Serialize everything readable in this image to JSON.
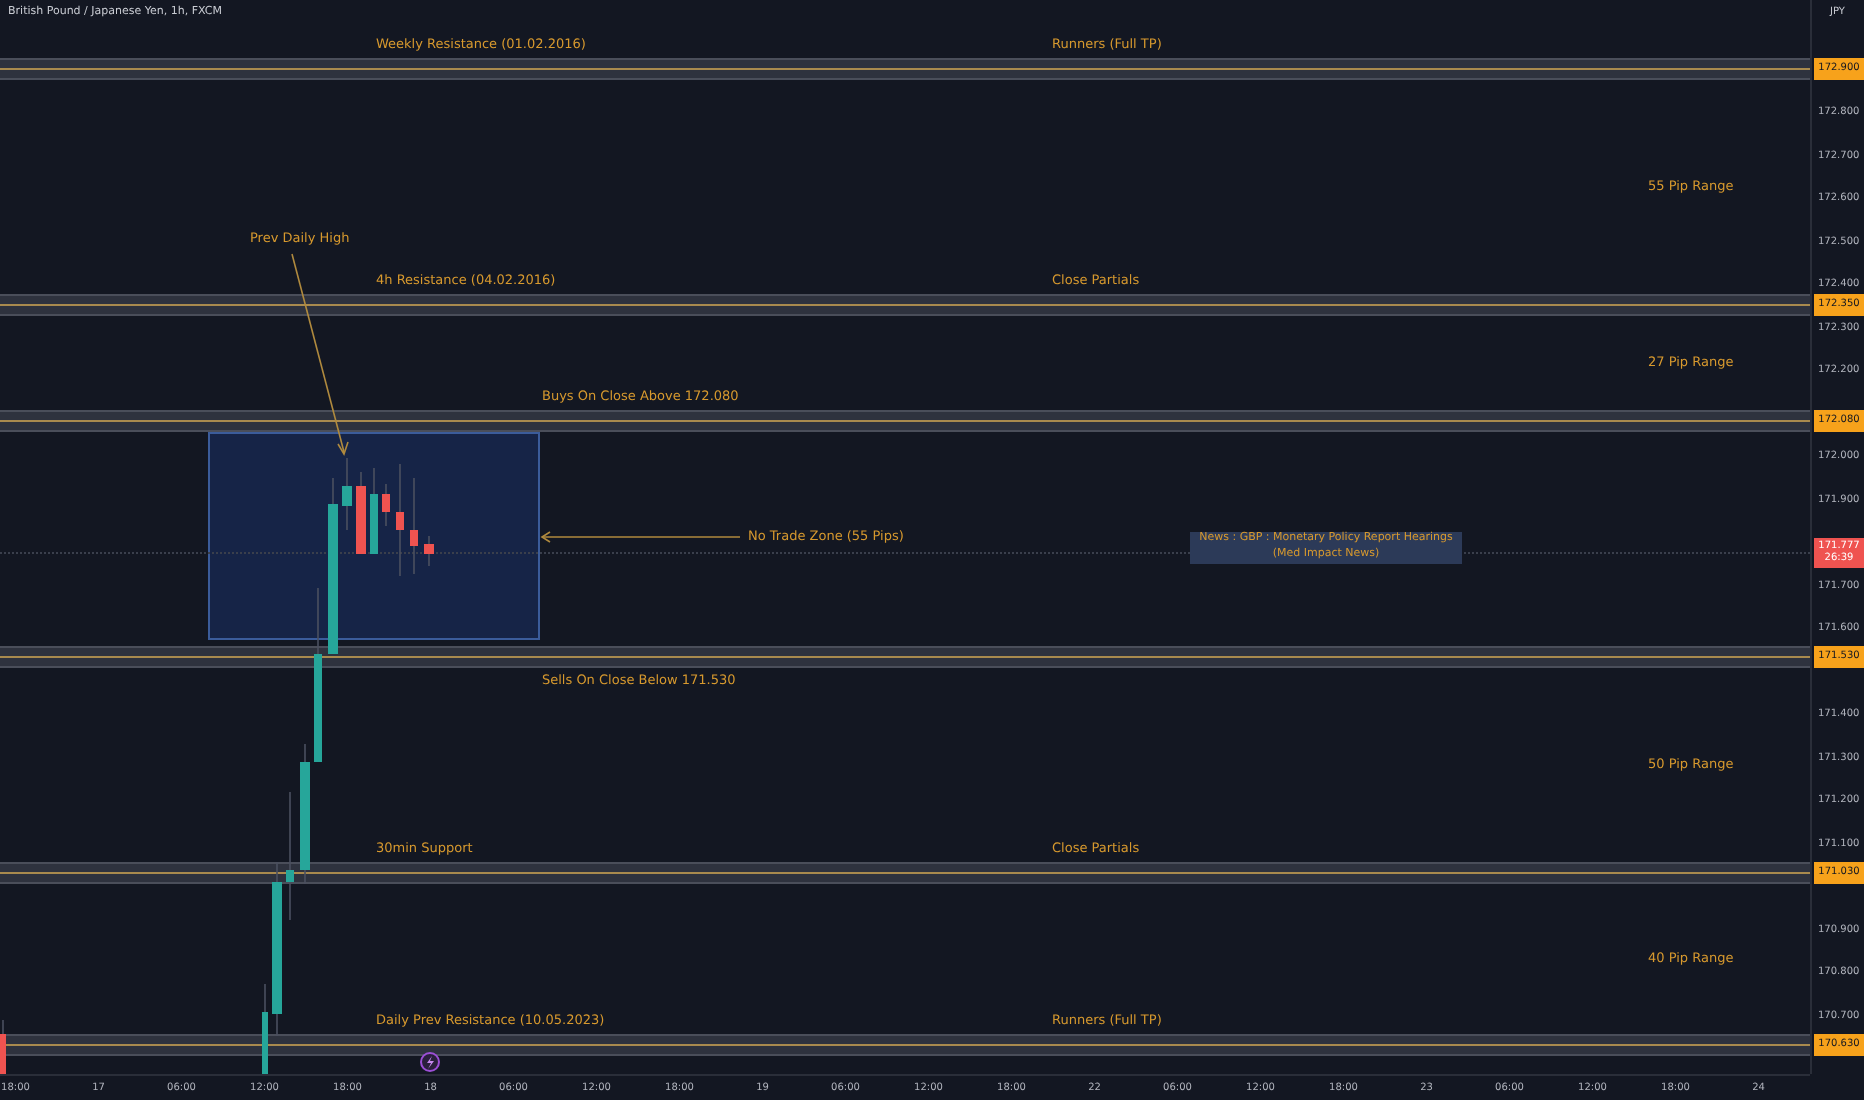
{
  "header": {
    "title": "British Pound / Japanese Yen, 1h, FXCM",
    "currency": "JPY"
  },
  "levels": [
    {
      "price": "172.900",
      "kind": "zone",
      "left_label": "Weekly Resistance (01.02.2016)",
      "right_label": "Runners (Full TP)",
      "range_below": "55 Pip Range"
    },
    {
      "price": "172.350",
      "kind": "zone",
      "left_label": "4h Resistance (04.02.2016)",
      "right_label": "Close Partials",
      "range_below": "27 Pip Range"
    },
    {
      "price": "172.080",
      "kind": "buy_trigger",
      "left_label": "Buys On Close Above 172.080"
    },
    {
      "price": "171.530",
      "kind": "sell_trigger",
      "left_label": "Sells On Close Below 171.530",
      "range_below": "50 Pip Range"
    },
    {
      "price": "171.030",
      "kind": "zone",
      "left_label": "30min Support",
      "right_label": "Close Partials",
      "range_below": "40 Pip Range"
    },
    {
      "price": "170.630",
      "kind": "zone",
      "left_label": "Daily Prev Resistance (10.05.2023)",
      "right_label": "Runners (Full TP)"
    }
  ],
  "annotations": {
    "prev_high": "Prev Daily High",
    "zone": "No Trade Zone (55 Pips)",
    "news": [
      "News : GBP : Monetary Policy Report Hearings",
      "(Med Impact News)"
    ]
  },
  "price_axis": {
    "ticks": [
      "172.800",
      "172.700",
      "172.600",
      "172.500",
      "172.400",
      "172.300",
      "172.200",
      "172.000",
      "171.900",
      "171.700",
      "171.600",
      "171.400",
      "171.300",
      "171.200",
      "171.100",
      "170.900",
      "170.800",
      "170.700"
    ],
    "current": {
      "price": "171.777",
      "countdown": "26:39"
    }
  },
  "time_axis": [
    "18:00",
    "17",
    "06:00",
    "12:00",
    "18:00",
    "18",
    "06:00",
    "12:00",
    "18:00",
    "19",
    "06:00",
    "12:00",
    "18:00",
    "22",
    "06:00",
    "12:00",
    "18:00",
    "23",
    "06:00",
    "12:00",
    "18:00",
    "24"
  ]
}
